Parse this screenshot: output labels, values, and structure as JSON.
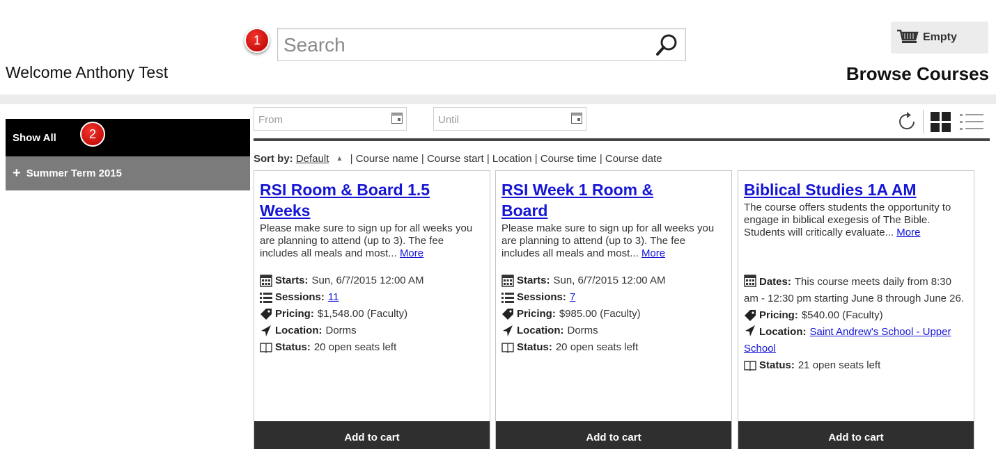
{
  "badges": {
    "one": "1",
    "two": "2"
  },
  "search": {
    "placeholder": "Search"
  },
  "cart": {
    "label": "Empty"
  },
  "header": {
    "welcome": "Welcome Anthony Test",
    "page_title": "Browse Courses"
  },
  "sidebar": {
    "items": [
      {
        "label": "Show All",
        "active": true
      },
      {
        "label": "Summer Term 2015",
        "expander": "+"
      }
    ]
  },
  "filters": {
    "from_placeholder": "From",
    "until_placeholder": "Until"
  },
  "sort": {
    "label": "Sort by:",
    "default": "Default",
    "options_text": "| Course name | Course start | Location | Course time | Course date"
  },
  "courses": [
    {
      "title_line1": "RSI Room & Board 1.5",
      "title_line2": "Weeks",
      "description": "Please make sure to sign up for all weeks you are planning to attend (up to 3). The fee includes all meals and most...",
      "more": "More",
      "starts_label": "Starts:",
      "starts": "Sun, 6/7/2015 12:00 AM",
      "sessions_label": "Sessions:",
      "sessions": "11",
      "pricing_label": "Pricing:",
      "pricing": "$1,548.00 (Faculty)",
      "location_label": "Location:",
      "location": "Dorms",
      "status_label": "Status:",
      "status": "20 open seats left",
      "button": "Add to cart"
    },
    {
      "title_line1": "RSI Week 1 Room &",
      "title_line2": "Board",
      "description": "Please make sure to sign up for all weeks you are planning to attend (up to 3). The fee includes all meals and most...",
      "more": "More",
      "starts_label": "Starts:",
      "starts": "Sun, 6/7/2015 12:00 AM",
      "sessions_label": "Sessions:",
      "sessions": "7",
      "pricing_label": "Pricing:",
      "pricing": "$985.00 (Faculty)",
      "location_label": "Location:",
      "location": "Dorms",
      "status_label": "Status:",
      "status": "20 open seats left",
      "button": "Add to cart"
    },
    {
      "title_line1": "Biblical Studies 1A AM",
      "description": "The course offers students the opportunity to engage in biblical exegesis of The Bible. Students will critically evaluate...",
      "more": "More",
      "dates_label": "Dates:",
      "dates": "This course meets daily from 8:30 am - 12:30 pm starting June 8 through June 26.",
      "pricing_label": "Pricing:",
      "pricing": "$540.00 (Faculty)",
      "location_label": "Location:",
      "location": "Saint Andrew's School - Upper School",
      "status_label": "Status:",
      "status": "21 open seats left",
      "button": "Add to cart"
    }
  ],
  "colors": {
    "link": "#1515d6",
    "badge": "#d4150f",
    "sidebar_active": "#000000",
    "sidebar_term": "#7b7b7b",
    "button": "#2f2f2f"
  }
}
